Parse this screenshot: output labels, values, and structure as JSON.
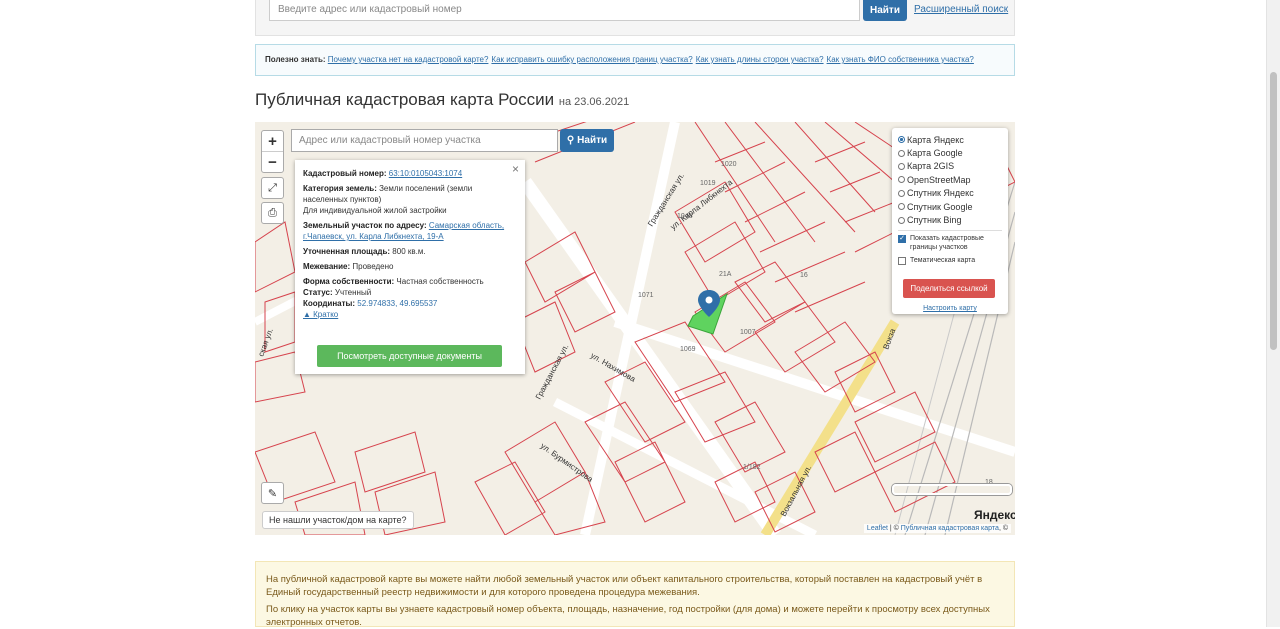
{
  "top_search": {
    "placeholder": "Введите адрес или кадастровый номер",
    "find_label": "Найти",
    "advanced_label": "Расширенный поиск"
  },
  "useful": {
    "prefix": "Полезно знать:",
    "links": [
      "Почему участка нет на кадастровой карте?",
      "Как исправить ошибку расположения границ участка?",
      "Как узнать длины сторон участка?",
      "Как узнать ФИО собственника участка?"
    ]
  },
  "page": {
    "title": "Публичная кадастровая карта России",
    "date": "на 23.06.2021"
  },
  "map": {
    "search_placeholder": "Адрес или кадастровый номер участка",
    "find_label": "Найти",
    "zoom_in": "+",
    "zoom_out": "−",
    "not_found": "Не нашли участок/дом на карте?",
    "yandex_logo": "Яндекс",
    "attribution_leaflet": "Leaflet",
    "attribution_sep": " | © ",
    "attribution_pkk": "Публичная кадастровая карта",
    "attribution_tail": ", ©",
    "labels": {
      "street_karla": "ул. Карла Либкнехта",
      "street_grazhd": "Гражданская ул.",
      "street_grazhd2": "Гражданская ул.",
      "street_nakhim": "ул. Нахимова",
      "street_vokz": "Вокзальная ул.",
      "street_vokz2": "Вокза",
      "street_burm": "ул. Бурмистрова",
      "street_left": "ская ул."
    },
    "icons": {
      "fullscreen": "fullscreen-icon",
      "print": "print-icon",
      "ruler": "ruler-icon",
      "marker": "location-marker-icon"
    }
  },
  "popup": {
    "cad_label": "Кадастровый номер:",
    "cad_value": "63:10:0105043:1074",
    "cat_label": "Категория земель:",
    "cat_value": "Земли поселений (земли населенных пунктов)",
    "use_value": "Для индивидуальной жилой застройки",
    "addr_label": "Земельный участок по адресу:",
    "addr_value": "Самарская область, г.Чапаевск, ул. Карла Либкнехта, 19-А",
    "area_label": "Уточненная площадь:",
    "area_value": "800 кв.м.",
    "survey_label": "Межевание:",
    "survey_value": "Проведено",
    "own_label": "Форма собственности:",
    "own_value": "Частная собственность",
    "status_label": "Статус:",
    "status_value": "Учтенный",
    "coord_label": "Координаты:",
    "coord_value": "52.974833, 49.695537",
    "brief_label": "▲ Кратко",
    "docs_button": "Посмотреть доступные документы",
    "close": "×"
  },
  "layers": {
    "options": [
      "Карта Яндекс",
      "Карта Google",
      "Карта 2GIS",
      "OpenStreetMap",
      "Спутник Яндекс",
      "Спутник Google",
      "Спутник Bing"
    ],
    "selected": "Карта Яндекс",
    "show_borders": "Показать кадастровые границы участков",
    "thematic": "Тематическая карта",
    "share_button": "Поделиться ссылкой",
    "tune_link": "Настроить карту"
  },
  "info": {
    "p1": "На публичной кадастровой карте вы можете найти любой земельный участок или объект капитального строительства, который поставлен на кадастровый учёт в Единый государственный реестр недвижимости и для которого проведена процедура межевания.",
    "p2": "По клику на участок карты вы узнаете кадастровый номер объекта, площадь, назначение, год постройки (для дома) и можете перейти к просмотру всех доступных электронных отчетов."
  },
  "colors": {
    "accent": "#2f6fa8",
    "parcel_border": "#d6434d",
    "selected_parcel": "#5fd35f",
    "share": "#d9534f",
    "docs": "#5cb85c"
  }
}
